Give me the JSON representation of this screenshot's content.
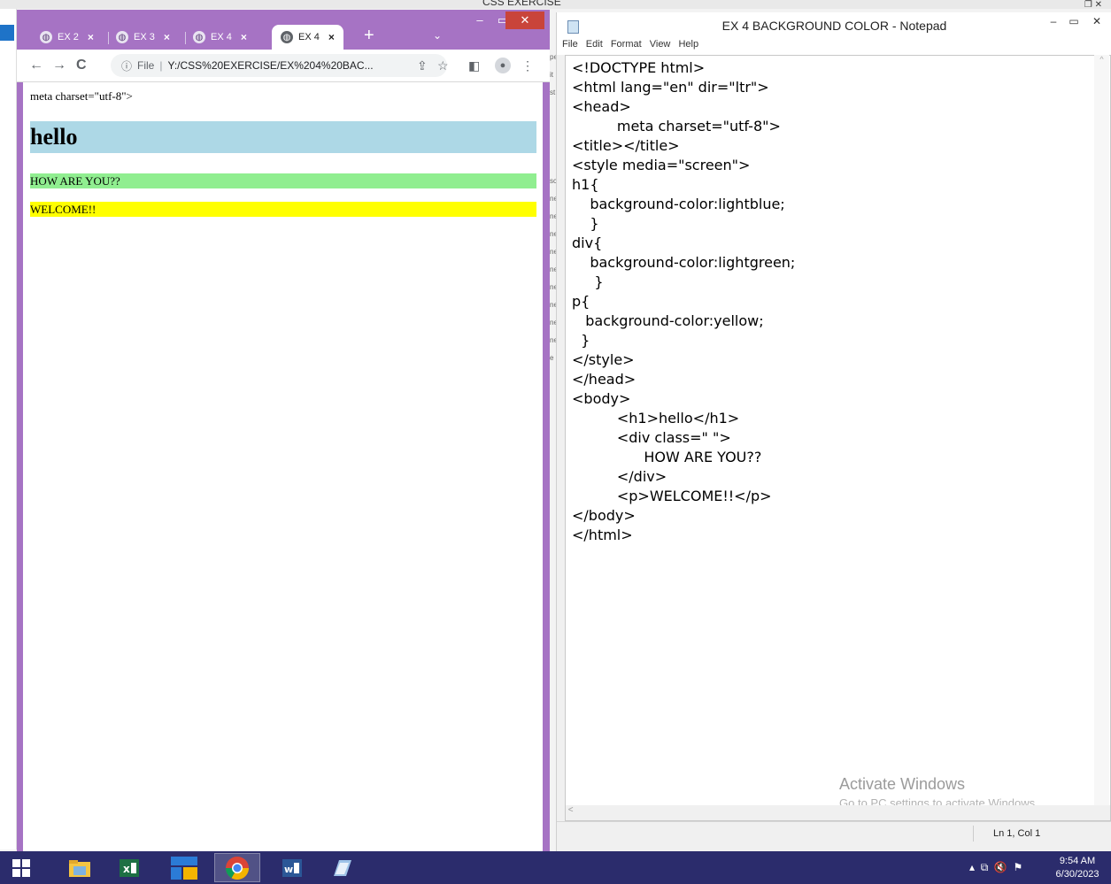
{
  "background_window": {
    "title": "CSS EXERCISE"
  },
  "chrome": {
    "tabs": [
      {
        "label": "EX 2",
        "active": false
      },
      {
        "label": "EX 3",
        "active": false
      },
      {
        "label": "EX 4",
        "active": false
      },
      {
        "label": "EX 4",
        "active": true
      }
    ],
    "tab_close_glyph": "×",
    "new_tab_glyph": "+",
    "tab_search_glyph": "⌄",
    "address": {
      "security_label": "File",
      "url": "Y:/CSS%20EXERCISE/EX%204%20BAC..."
    },
    "page": {
      "meta_text": "meta charset=\"utf-8\">",
      "h1": "hello",
      "div": "HOW ARE YOU??",
      "p": "WELCOME!!",
      "colors": {
        "h1_bg": "lightblue",
        "div_bg": "lightgreen",
        "p_bg": "yellow"
      }
    },
    "frame_color": "#a673c4"
  },
  "notepad": {
    "title": "EX 4 BACKGROUND COLOR - Notepad",
    "menu": [
      "File",
      "Edit",
      "Format",
      "View",
      "Help"
    ],
    "lines": [
      "<!DOCTYPE html>",
      "<html lang=\"en\" dir=\"ltr\">",
      "<head>",
      "          meta charset=\"utf-8\">",
      "<title></title>",
      "<style media=\"screen\">",
      "h1{",
      "    background-color:lightblue;",
      "    }",
      "div{",
      "    background-color:lightgreen;",
      "     }",
      "p{",
      "   background-color:yellow;",
      "  }",
      "</style>",
      "</head>",
      "<body>",
      "          <h1>hello</h1>",
      "          <div class=\" \">",
      "                HOW ARE YOU??",
      "          </div>",
      "          <p>WELCOME!!</p>",
      "</body>",
      "</html>"
    ],
    "watermark_title": "Activate Windows",
    "watermark_sub": "Go to PC settings to activate Windows.",
    "status_position": "Ln 1, Col 1"
  },
  "taskbar": {
    "apps": [
      "start-button",
      "file-explorer",
      "excel",
      "unknown-app",
      "chrome",
      "word",
      "notepad"
    ],
    "time": "9:54 AM",
    "date": "6/30/2023",
    "color": "#2b2c6c"
  }
}
